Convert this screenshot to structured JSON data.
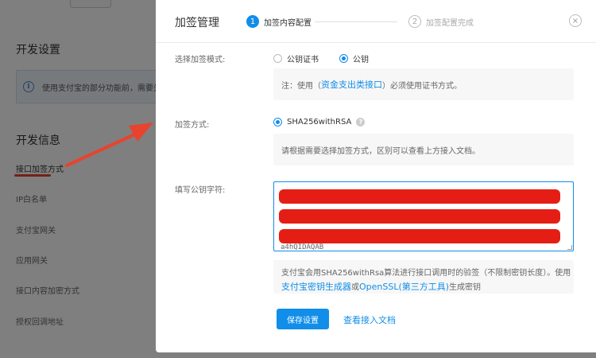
{
  "background": {
    "section_dev_settings": "开发设置",
    "notice_text": "使用支付宝的部分功能前，需要先",
    "section_dev_info": "开发信息",
    "labels": [
      "接口加签方式",
      "IP白名单",
      "支付宝网关",
      "应用网关",
      "接口内容加密方式",
      "授权回调地址"
    ]
  },
  "modal": {
    "title": "加签管理",
    "steps": [
      {
        "num": "1",
        "label": "加签内容配置"
      },
      {
        "num": "2",
        "label": "加签配置完成"
      }
    ],
    "close": "×"
  },
  "form": {
    "mode_label": "选择加签模式:",
    "mode_options": [
      "公钥证书",
      "公钥"
    ],
    "mode_note_prefix": "注：使用（",
    "mode_note_link": "资金支出类接口",
    "mode_note_suffix": "）必须使用证书方式。",
    "method_label": "加签方式:",
    "method_option": "SHA256withRSA",
    "method_help": "?",
    "method_note": "请根据需要选择加签方式，区别可以查看上方接入文档。",
    "key_label": "填写公钥字符:",
    "key_tail": "a4hQIDAQAB",
    "key_note_line1": "支付宝会用SHA256withRsa算法进行接口调用时的验签（不限制密钥长度）。使用",
    "key_note_link1": "支付宝密钥生成器",
    "key_note_or": "或",
    "key_note_link2": "OpenSSL(第三方工具)",
    "key_note_suffix": "生成密钥"
  },
  "actions": {
    "save": "保存设置",
    "docs": "查看接入文档"
  },
  "colors": {
    "accent": "#108ee9",
    "annotation_red": "#e8432e"
  }
}
